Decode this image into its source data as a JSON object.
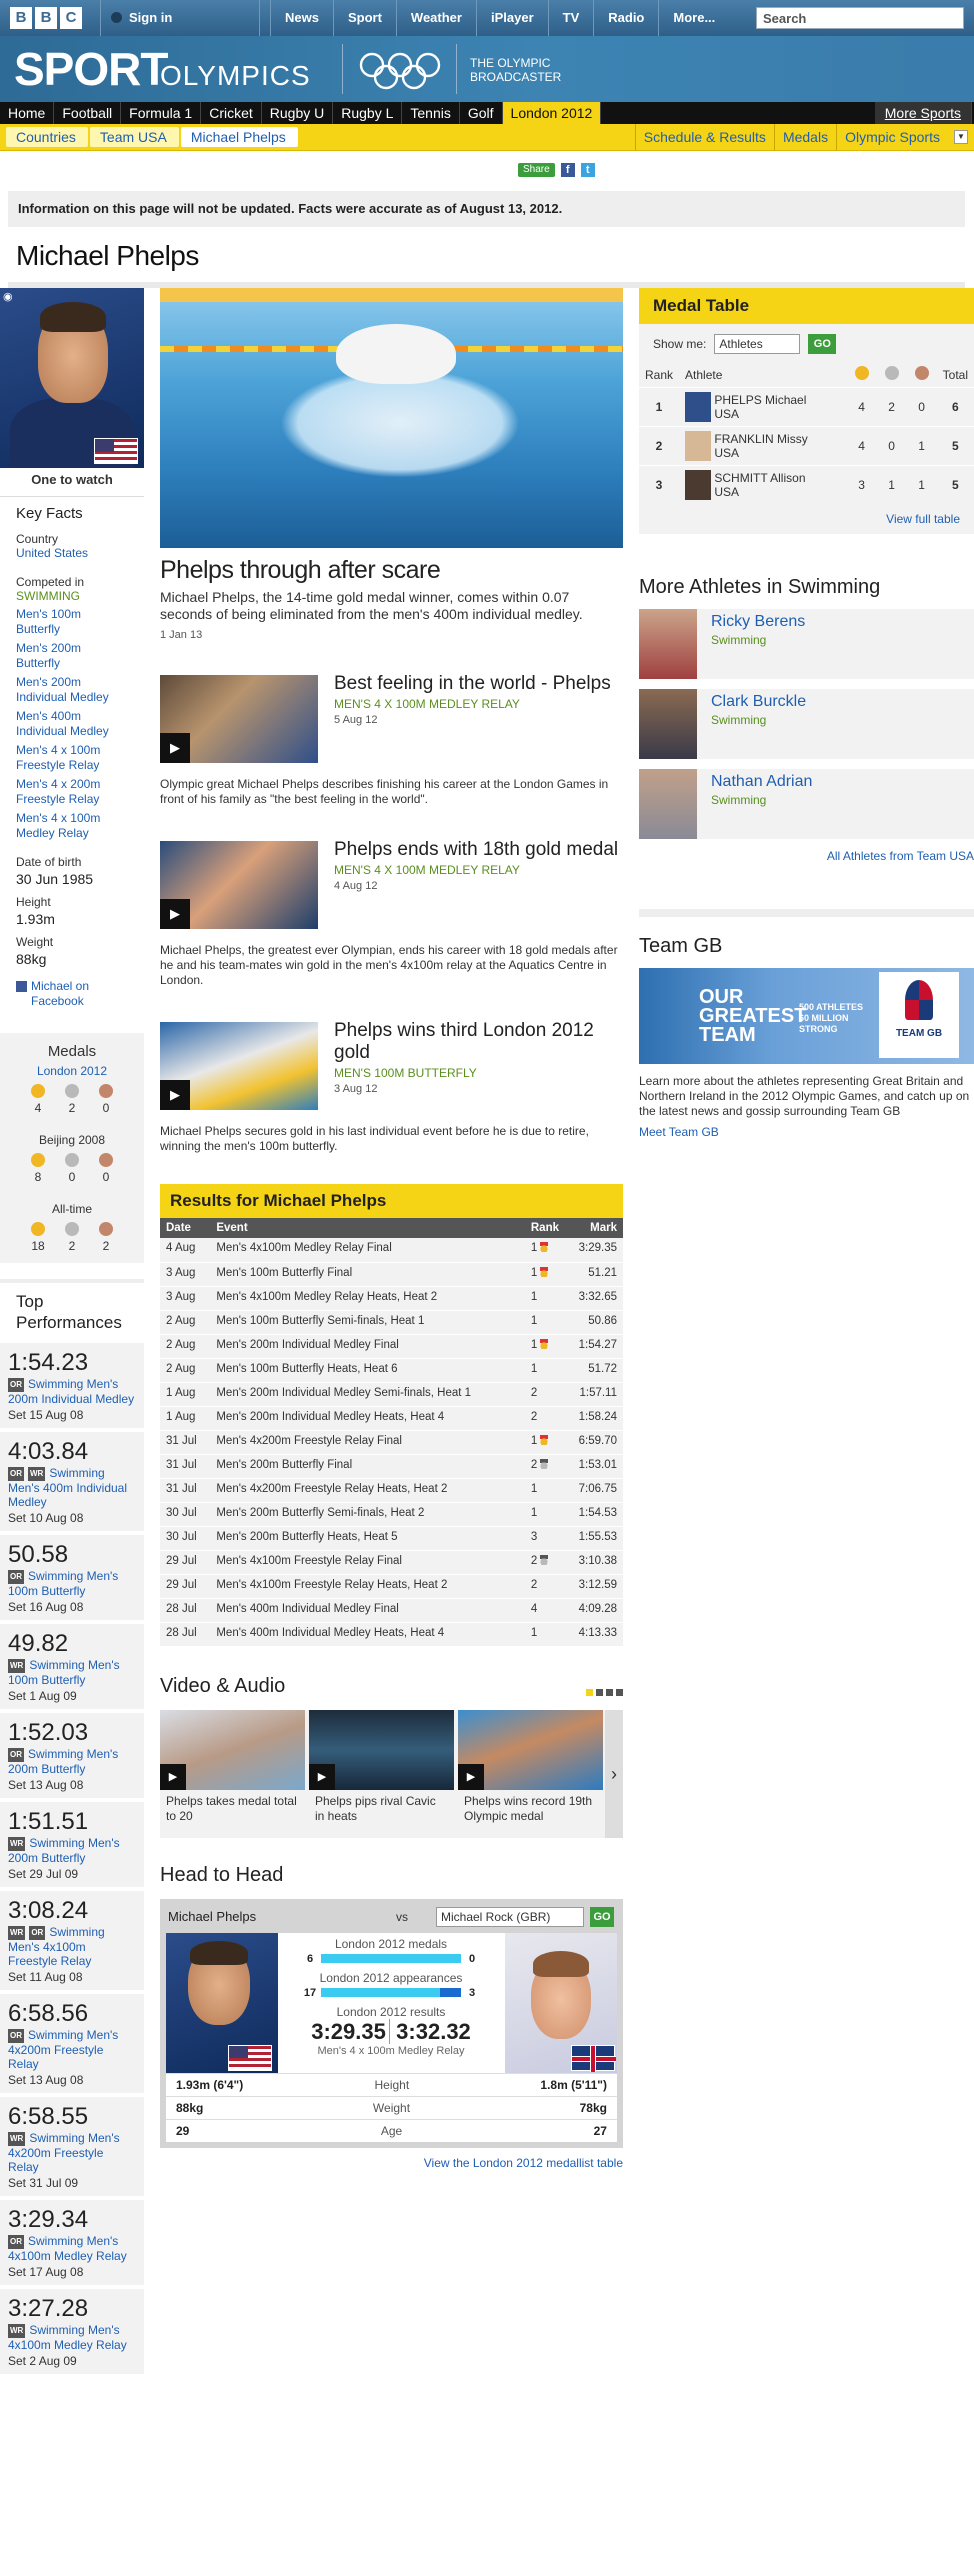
{
  "header": {
    "signin": "Sign in",
    "nav": [
      "News",
      "Sport",
      "Weather",
      "iPlayer",
      "TV",
      "Radio",
      "More..."
    ],
    "search_placeholder": "Search"
  },
  "banner": {
    "sport": "SPORT",
    "section": "OLYMPICS",
    "broadcaster_line1": "THE OLYMPIC",
    "broadcaster_line2": "BROADCASTER"
  },
  "sportnav": {
    "items": [
      "Home",
      "Football",
      "Formula 1",
      "Cricket",
      "Rugby U",
      "Rugby L",
      "Tennis",
      "Golf",
      "London 2012"
    ],
    "more": "More Sports"
  },
  "subnav": {
    "crumbs": [
      "Countries",
      "Team USA",
      "Michael Phelps"
    ],
    "links": [
      "Schedule & Results",
      "Medals",
      "Olympic Sports"
    ]
  },
  "share": {
    "label": "Share",
    "fb": "f",
    "tw": "t"
  },
  "notice": "Information on this page will not be updated. Facts were accurate as of August 13, 2012.",
  "page_title": "Michael Phelps",
  "profile": {
    "one_to_watch": "One to watch",
    "key_facts_title": "Key Facts",
    "country_label": "Country",
    "country": "United States",
    "competed_label": "Competed in",
    "sport": "SWIMMING",
    "events": [
      "Men's 100m Butterfly",
      "Men's 200m Butterfly",
      "Men's 200m Individual Medley",
      "Men's 400m Individual Medley",
      "Men's 4 x 100m Freestyle Relay",
      "Men's 4 x 200m Freestyle Relay",
      "Men's 4 x 100m Medley Relay"
    ],
    "dob_label": "Date of birth",
    "dob": "30 Jun 1985",
    "height_label": "Height",
    "height": "1.93m",
    "weight_label": "Weight",
    "weight": "88kg",
    "facebook": "Michael on Facebook"
  },
  "medals": {
    "title": "Medals",
    "london_label": "London 2012",
    "london": [
      "4",
      "2",
      "0"
    ],
    "beijing_label": "Beijing 2008",
    "beijing": [
      "8",
      "0",
      "0"
    ],
    "alltime_label": "All-time",
    "alltime": [
      "18",
      "2",
      "2"
    ]
  },
  "top_perf": {
    "title": "Top Performances",
    "items": [
      {
        "time": "1:54.23",
        "tags": [
          "OR"
        ],
        "event": "Swimming Men's 200m Individual Medley",
        "set": "Set 15 Aug 08"
      },
      {
        "time": "4:03.84",
        "tags": [
          "OR",
          "WR"
        ],
        "event": "Swimming Men's 400m Individual Medley",
        "set": "Set 10 Aug 08"
      },
      {
        "time": "50.58",
        "tags": [
          "OR"
        ],
        "event": "Swimming Men's 100m Butterfly",
        "set": "Set 16 Aug 08"
      },
      {
        "time": "49.82",
        "tags": [
          "WR"
        ],
        "event": "Swimming Men's 100m Butterfly",
        "set": "Set 1 Aug 09"
      },
      {
        "time": "1:52.03",
        "tags": [
          "OR"
        ],
        "event": "Swimming Men's 200m Butterfly",
        "set": "Set 13 Aug 08"
      },
      {
        "time": "1:51.51",
        "tags": [
          "WR"
        ],
        "event": "Swimming Men's 200m Butterfly",
        "set": "Set 29 Jul 09"
      },
      {
        "time": "3:08.24",
        "tags": [
          "WR",
          "OR"
        ],
        "event": "Swimming Men's 4x100m Freestyle Relay",
        "set": "Set 11 Aug 08"
      },
      {
        "time": "6:58.56",
        "tags": [
          "OR"
        ],
        "event": "Swimming Men's 4x200m Freestyle Relay",
        "set": "Set 13 Aug 08"
      },
      {
        "time": "6:58.55",
        "tags": [
          "WR"
        ],
        "event": "Swimming Men's 4x200m Freestyle Relay",
        "set": "Set 31 Jul 09"
      },
      {
        "time": "3:29.34",
        "tags": [
          "OR"
        ],
        "event": "Swimming Men's 4x100m Medley Relay",
        "set": "Set 17 Aug 08"
      },
      {
        "time": "3:27.28",
        "tags": [
          "WR"
        ],
        "event": "Swimming Men's 4x100m Medley Relay",
        "set": "Set 2 Aug 09"
      }
    ]
  },
  "main_story": {
    "title": "Phelps through after scare",
    "summary": "Michael Phelps, the 14-time gold medal winner, comes within 0.07 seconds of being eliminated from the men's 400m individual medley.",
    "date": "1 Jan 13"
  },
  "stories": [
    {
      "title": "Best feeling in the world - Phelps",
      "cat": "MEN'S 4 X 100M MEDLEY RELAY",
      "date": "5 Aug 12",
      "desc": "Olympic great Michael Phelps describes finishing his career at the London Games in front of his family as \"the best feeling in the world\"."
    },
    {
      "title": "Phelps ends with 18th gold medal",
      "cat": "MEN'S 4 X 100M MEDLEY RELAY",
      "date": "4 Aug 12",
      "desc": "Michael Phelps, the greatest ever Olympian, ends his career with 18 gold medals after he and his team-mates win gold in the men's 4x100m relay at the Aquatics Centre in London."
    },
    {
      "title": "Phelps wins third London 2012 gold",
      "cat": "MEN'S 100M BUTTERFLY",
      "date": "3 Aug 12",
      "desc": "Michael Phelps secures gold in his last individual event before he is due to retire, winning the men's 100m butterfly."
    }
  ],
  "results": {
    "title": "Results for Michael Phelps",
    "headers": [
      "Date",
      "Event",
      "Rank",
      "Mark"
    ],
    "rows": [
      {
        "date": "4 Aug",
        "event": "Men's 4x100m Medley Relay Final",
        "rank": "1",
        "medal": "gold",
        "mark": "3:29.35"
      },
      {
        "date": "3 Aug",
        "event": "Men's 100m Butterfly Final",
        "rank": "1",
        "medal": "gold",
        "mark": "51.21"
      },
      {
        "date": "3 Aug",
        "event": "Men's 4x100m Medley Relay Heats, Heat 2",
        "rank": "1",
        "medal": "",
        "mark": "3:32.65"
      },
      {
        "date": "2 Aug",
        "event": "Men's 100m Butterfly Semi-finals, Heat 1",
        "rank": "1",
        "medal": "",
        "mark": "50.86"
      },
      {
        "date": "2 Aug",
        "event": "Men's 200m Individual Medley Final",
        "rank": "1",
        "medal": "gold",
        "mark": "1:54.27"
      },
      {
        "date": "2 Aug",
        "event": "Men's 100m Butterfly Heats, Heat 6",
        "rank": "1",
        "medal": "",
        "mark": "51.72"
      },
      {
        "date": "1 Aug",
        "event": "Men's 200m Individual Medley Semi-finals, Heat 1",
        "rank": "2",
        "medal": "",
        "mark": "1:57.11"
      },
      {
        "date": "1 Aug",
        "event": "Men's 200m Individual Medley Heats, Heat 4",
        "rank": "2",
        "medal": "",
        "mark": "1:58.24"
      },
      {
        "date": "31 Jul",
        "event": "Men's 4x200m Freestyle Relay Final",
        "rank": "1",
        "medal": "gold",
        "mark": "6:59.70"
      },
      {
        "date": "31 Jul",
        "event": "Men's 200m Butterfly Final",
        "rank": "2",
        "medal": "silver",
        "mark": "1:53.01"
      },
      {
        "date": "31 Jul",
        "event": "Men's 4x200m Freestyle Relay Heats, Heat 2",
        "rank": "1",
        "medal": "",
        "mark": "7:06.75"
      },
      {
        "date": "30 Jul",
        "event": "Men's 200m Butterfly Semi-finals, Heat 2",
        "rank": "1",
        "medal": "",
        "mark": "1:54.53"
      },
      {
        "date": "30 Jul",
        "event": "Men's 200m Butterfly Heats, Heat 5",
        "rank": "3",
        "medal": "",
        "mark": "1:55.53"
      },
      {
        "date": "29 Jul",
        "event": "Men's 4x100m Freestyle Relay Final",
        "rank": "2",
        "medal": "silver",
        "mark": "3:10.38"
      },
      {
        "date": "29 Jul",
        "event": "Men's 4x100m Freestyle Relay Heats, Heat 2",
        "rank": "2",
        "medal": "",
        "mark": "3:12.59"
      },
      {
        "date": "28 Jul",
        "event": "Men's 400m Individual Medley Final",
        "rank": "4",
        "medal": "",
        "mark": "4:09.28"
      },
      {
        "date": "28 Jul",
        "event": "Men's 400m Individual Medley Heats, Heat 4",
        "rank": "1",
        "medal": "",
        "mark": "4:13.33"
      }
    ]
  },
  "video": {
    "title": "Video & Audio",
    "items": [
      "Phelps takes medal total to 20",
      "Phelps pips rival Cavic in heats",
      "Phelps wins record 19th Olympic medal"
    ]
  },
  "h2h": {
    "title": "Head to Head",
    "player1": "Michael Phelps",
    "vs": "vs",
    "player2_select": "Michael Rock (GBR)",
    "go": "GO",
    "medals_label": "London 2012 medals",
    "medals": [
      "6",
      "0"
    ],
    "apps_label": "London 2012 appearances",
    "apps": [
      "17",
      "3"
    ],
    "results_label": "London 2012 results",
    "res1": "3:29.35",
    "res2": "3:32.32",
    "res_event": "Men's 4 x 100m Medley Relay",
    "height": {
      "p1": "1.93m (6'4\")",
      "label": "Height",
      "p2": "1.8m (5'11\")"
    },
    "weight": {
      "p1": "88kg",
      "label": "Weight",
      "p2": "78kg"
    },
    "age": {
      "p1": "29",
      "label": "Age",
      "p2": "27"
    },
    "view_table": "View the London 2012 medallist table"
  },
  "medal_table": {
    "title": "Medal Table",
    "show_label": "Show me:",
    "show_value": "Athletes",
    "go": "GO",
    "headers": [
      "Rank",
      "Athlete",
      "Total"
    ],
    "rows": [
      {
        "rank": "1",
        "name": "PHELPS Michael USA",
        "g": "4",
        "s": "2",
        "b": "0",
        "t": "6"
      },
      {
        "rank": "2",
        "name": "FRANKLIN Missy USA",
        "g": "4",
        "s": "0",
        "b": "1",
        "t": "5"
      },
      {
        "rank": "3",
        "name": "SCHMITT Allison USA",
        "g": "3",
        "s": "1",
        "b": "1",
        "t": "5"
      }
    ],
    "full": "View full table"
  },
  "more_athletes": {
    "title": "More Athletes in Swimming",
    "items": [
      {
        "name": "Ricky Berens",
        "sport": "Swimming"
      },
      {
        "name": "Clark Burckle",
        "sport": "Swimming"
      },
      {
        "name": "Nathan Adrian",
        "sport": "Swimming"
      }
    ],
    "all": "All Athletes from Team USA"
  },
  "teamgb": {
    "title": "Team GB",
    "banner_big": "OUR GREATEST TEAM",
    "banner_small": "500 ATHLETES 60 MILLION STRONG",
    "logo_text": "TEAM GB",
    "desc": "Learn more about the athletes representing Great Britain and Northern Ireland in the 2012 Olympic Games, and catch up on the latest news and gossip surrounding Team GB",
    "link": "Meet Team GB"
  }
}
